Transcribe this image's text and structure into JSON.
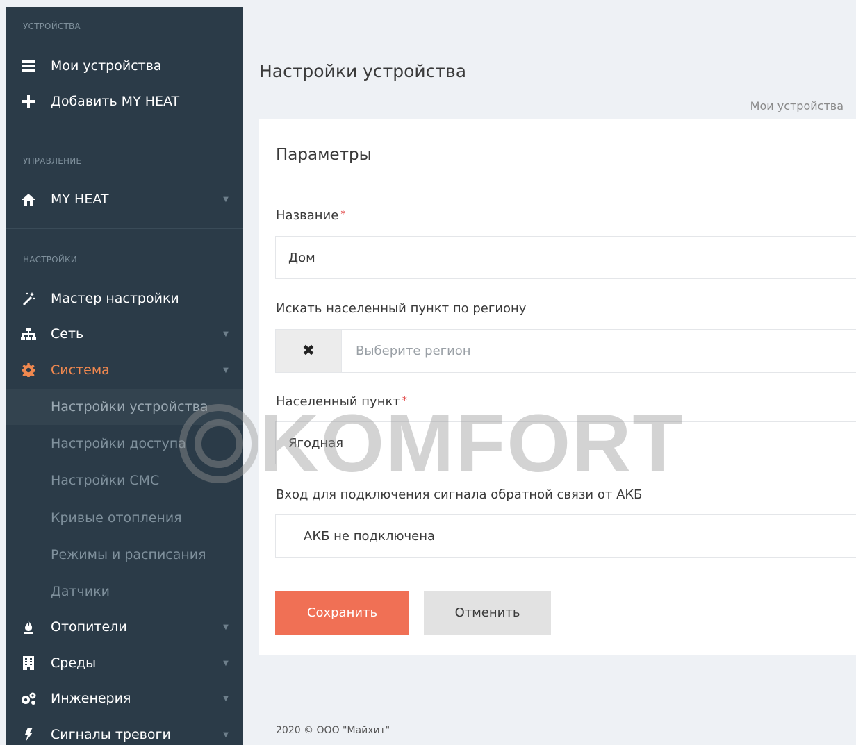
{
  "sidebar": {
    "sections": [
      {
        "header": "УСТРОЙСТВА"
      },
      {
        "header": "УПРАВЛЕНИЕ"
      },
      {
        "header": "НАСТРОЙКИ"
      }
    ],
    "items": {
      "my_devices": {
        "label": "Мои устройства",
        "icon": "grid-icon"
      },
      "add_myheat": {
        "label": "Добавить MY HEAT",
        "icon": "plus-icon"
      },
      "myheat": {
        "label": "MY HEAT",
        "icon": "home-icon"
      },
      "wizard": {
        "label": "Мастер настройки",
        "icon": "magic-wand-icon"
      },
      "network": {
        "label": "Сеть",
        "icon": "sitemap-icon"
      },
      "system": {
        "label": "Система",
        "icon": "gear-icon"
      },
      "heaters": {
        "label": "Отопители",
        "icon": "flame-icon"
      },
      "environments": {
        "label": "Среды",
        "icon": "building-icon"
      },
      "engineering": {
        "label": "Инженерия",
        "icon": "cogs-icon"
      },
      "alarms": {
        "label": "Сигналы тревоги",
        "icon": "bolt-icon"
      }
    },
    "system_sub": [
      {
        "label": "Настройки устройства"
      },
      {
        "label": "Настройки доступа"
      },
      {
        "label": "Настройки СМС"
      },
      {
        "label": "Кривые отопления"
      },
      {
        "label": "Режимы и расписания"
      },
      {
        "label": "Датчики"
      }
    ]
  },
  "page": {
    "title": "Настройки устройства",
    "breadcrumb": "Мои устройства"
  },
  "form": {
    "title": "Параметры",
    "name_label": "Название",
    "name_value": "Дом",
    "region_label": "Искать населенный пункт по региону",
    "region_placeholder": "Выберите регион",
    "locality_label": "Населенный пункт",
    "locality_value": "Ягодная",
    "battery_label": "Вход для подключения сигнала обратной связи от АКБ",
    "battery_value": "АКБ не подключена",
    "save": "Сохранить",
    "cancel": "Отменить",
    "required_mark": "*"
  },
  "footer": "2020 © ООО \"Майхит\"",
  "watermark": "KOMFORT",
  "colors": {
    "sidebar_bg": "#2b3b48",
    "accent": "#f0884f",
    "save_button": "#f07055"
  }
}
